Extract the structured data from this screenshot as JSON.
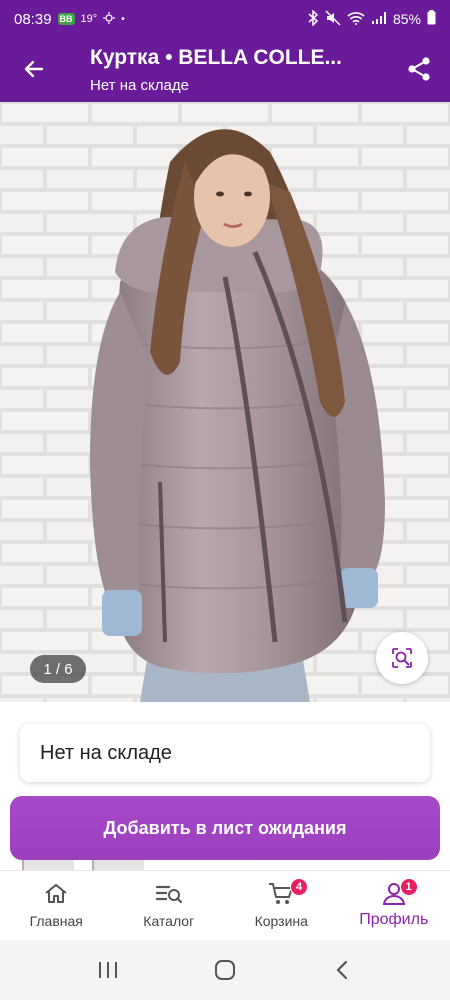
{
  "status_bar": {
    "time": "08:39",
    "app_badge": "BB",
    "temperature": "19°",
    "dot": "•",
    "battery": "85%"
  },
  "app_bar": {
    "title": "Куртка • BELLA COLLE...",
    "subtitle": "Нет на складе",
    "icons": [
      "back-arrow-icon",
      "share-icon"
    ]
  },
  "gallery": {
    "counter": "1 / 6",
    "icons": [
      "visual-search-icon"
    ]
  },
  "stock": {
    "status_text": "Нет на складе"
  },
  "actions": {
    "waitlist_label": "Добавить в лист ожидания"
  },
  "bottom_nav": {
    "items": [
      {
        "label": "Главная",
        "icon": "home-icon"
      },
      {
        "label": "Каталог",
        "icon": "catalog-search-icon"
      },
      {
        "label": "Корзина",
        "icon": "cart-icon",
        "badge": "4"
      },
      {
        "label": "Профиль",
        "icon": "profile-icon",
        "badge": "1",
        "active": true
      }
    ]
  },
  "colors": {
    "brand": "#6a1b9a",
    "button": "#a044c4",
    "active_nav": "#8e24aa",
    "badge": "#e91e63"
  }
}
